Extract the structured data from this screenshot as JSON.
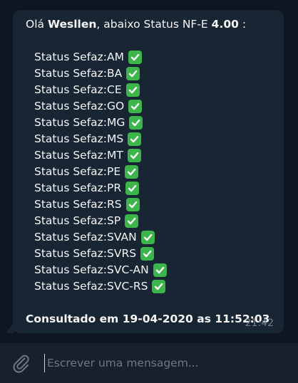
{
  "message": {
    "greeting_prefix": "Olá ",
    "user_name": "Wesllen",
    "greeting_middle": ", abaixo Status NF-E ",
    "version": "4.00",
    "greeting_suffix": " :",
    "status_label": "Status Sefaz:",
    "status_items": [
      {
        "state": "AM",
        "icon": "check-mark-icon"
      },
      {
        "state": "BA",
        "icon": "check-mark-icon"
      },
      {
        "state": "CE",
        "icon": "check-mark-icon"
      },
      {
        "state": "GO",
        "icon": "check-mark-icon"
      },
      {
        "state": "MG",
        "icon": "check-mark-icon"
      },
      {
        "state": "MS",
        "icon": "check-mark-icon"
      },
      {
        "state": "MT",
        "icon": "check-mark-icon"
      },
      {
        "state": "PE",
        "icon": "check-mark-icon"
      },
      {
        "state": "PR",
        "icon": "check-mark-icon"
      },
      {
        "state": "RS",
        "icon": "check-mark-icon"
      },
      {
        "state": "SP",
        "icon": "check-mark-icon"
      },
      {
        "state": "SVAN",
        "icon": "check-mark-icon"
      },
      {
        "state": "SVRS",
        "icon": "check-mark-icon"
      },
      {
        "state": "SVC-AN",
        "icon": "check-mark-icon"
      },
      {
        "state": "SVC-RS",
        "icon": "check-mark-icon"
      }
    ],
    "consulted_at": "Consultado em 19-04-2020 as 11:52:03",
    "time": "21:42"
  },
  "composer": {
    "placeholder": "Escrever uma mensagem...",
    "attach_icon": "paperclip-icon"
  },
  "colors": {
    "background": "#0e1621",
    "bubble": "#182533",
    "composer": "#17212b",
    "check": "#3cb54a",
    "time": "#6d7f8f",
    "placeholder": "#6d7883"
  }
}
